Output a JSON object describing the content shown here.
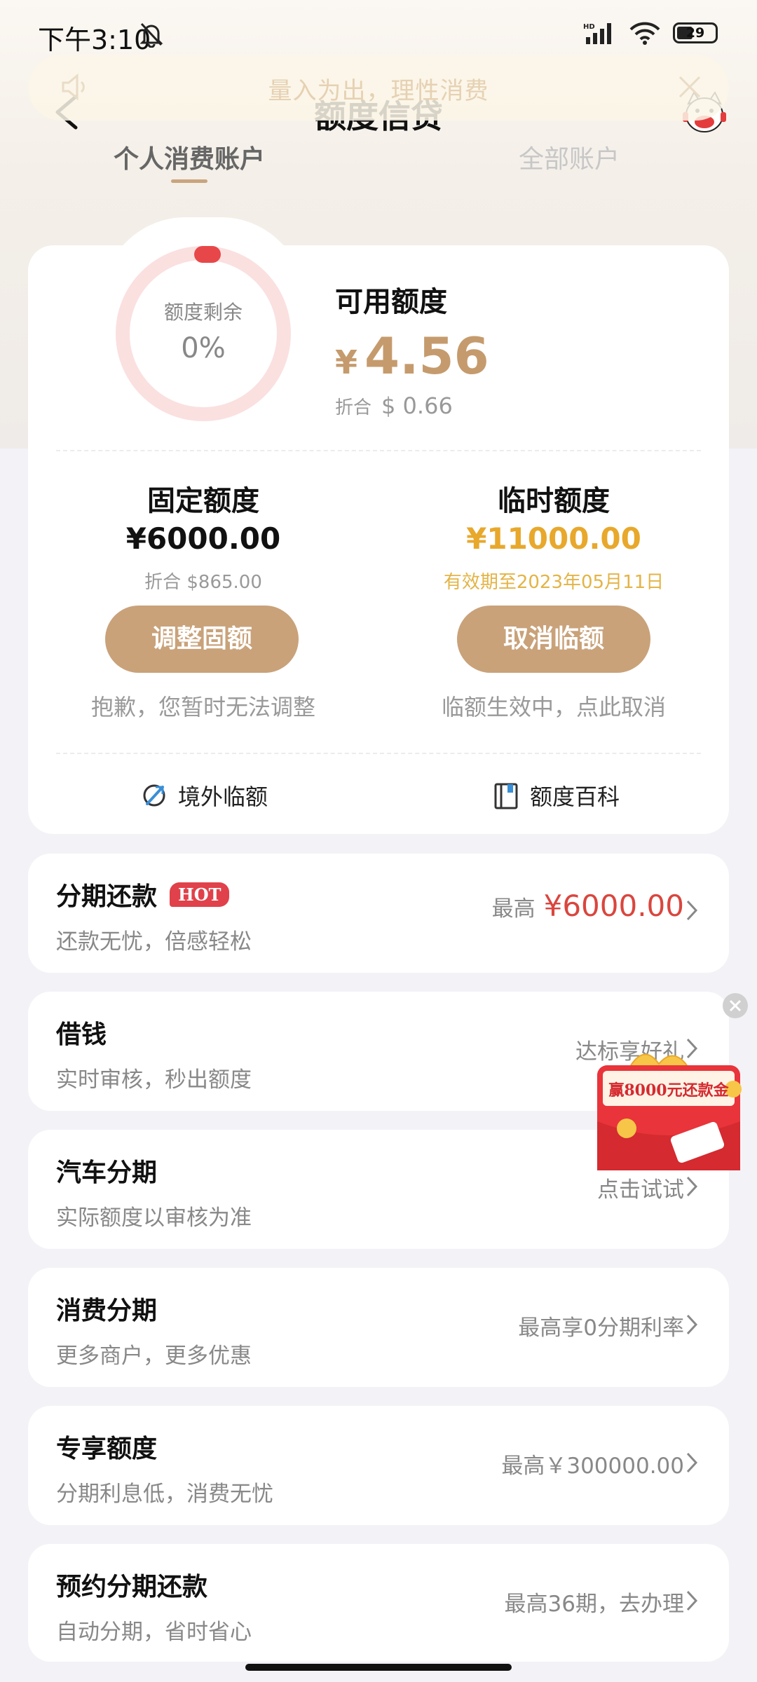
{
  "status_bar": {
    "time": "下午3:10",
    "battery": "29"
  },
  "notice": {
    "text": "量入为出，理性消费"
  },
  "nav": {
    "title": "额度信贷"
  },
  "tabs": [
    {
      "label": "个人消费账户",
      "active": true
    },
    {
      "label": "全部账户",
      "active": false
    }
  ],
  "credit": {
    "ring_label": "额度剩余",
    "ring_value": "0%",
    "ring_fraction": 0.0,
    "available_title": "可用额度",
    "available_currency": "¥",
    "available_amount": "4.56",
    "usd_label": "折合",
    "usd_amount": "$ 0.66",
    "fixed": {
      "title": "固定额度",
      "amount": "¥6000.00",
      "sub": "折合 $865.00",
      "button": "调整固额",
      "note": "抱歉，您暂时无法调整"
    },
    "temporary": {
      "title": "临时额度",
      "amount": "¥11000.00",
      "sub": "有效期至2023年05月11日",
      "button": "取消临额",
      "note": "临额生效中，点此取消"
    },
    "links": {
      "overseas": "境外临额",
      "wiki": "额度百科"
    }
  },
  "services": [
    {
      "title": "分期还款",
      "badge": "HOT",
      "sub": "还款无忧，倍感轻松",
      "right_prefix": "最高",
      "right_value": "¥6000.00"
    },
    {
      "title": "借钱",
      "sub": "实时审核，秒出额度",
      "right": "达标享好礼"
    },
    {
      "title": "汽车分期",
      "sub": "实际额度以审核为准",
      "right": "点击试试"
    },
    {
      "title": "消费分期",
      "sub": "更多商户，更多优惠",
      "right": "最高享0分期利率"
    },
    {
      "title": "专享额度",
      "sub": "分期利息低，消费无忧",
      "right": "最高￥300000.00"
    },
    {
      "title": "预约分期还款",
      "sub": "自动分期，省时省心",
      "right": "最高36期，去办理"
    }
  ],
  "promo": {
    "text": "赢8000元还款金"
  },
  "colors": {
    "accent": "#c9a27a",
    "gold": "#e8a82c",
    "red": "#d9463e",
    "ring_track": "#fbe0e0",
    "ring_dot": "#e8474a"
  }
}
